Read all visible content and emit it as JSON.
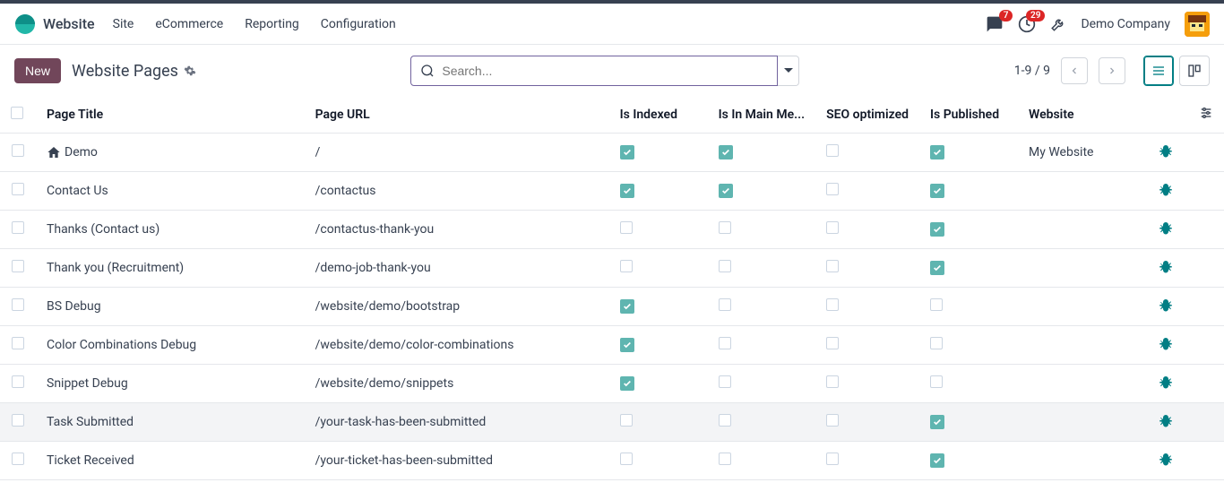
{
  "brand": {
    "name": "Website"
  },
  "nav": {
    "items": [
      "Site",
      "eCommerce",
      "Reporting",
      "Configuration"
    ]
  },
  "notifications": {
    "messages": "7",
    "activities": "29"
  },
  "company": "Demo Company",
  "controls": {
    "new_label": "New",
    "title": "Website Pages",
    "search_placeholder": "Search...",
    "pager": "1-9 / 9"
  },
  "columns": [
    "Page Title",
    "Page URL",
    "Is Indexed",
    "Is In Main Me...",
    "SEO optimized",
    "Is Published",
    "Website"
  ],
  "rows": [
    {
      "title": "Demo",
      "home": true,
      "url": "/",
      "indexed": true,
      "mainmenu": true,
      "seo": false,
      "published": true,
      "website": "My Website",
      "highlight": false
    },
    {
      "title": "Contact Us",
      "home": false,
      "url": "/contactus",
      "indexed": true,
      "mainmenu": true,
      "seo": false,
      "published": true,
      "website": "",
      "highlight": false
    },
    {
      "title": "Thanks (Contact us)",
      "home": false,
      "url": "/contactus-thank-you",
      "indexed": false,
      "mainmenu": false,
      "seo": false,
      "published": true,
      "website": "",
      "highlight": false
    },
    {
      "title": "Thank you (Recruitment)",
      "home": false,
      "url": "/demo-job-thank-you",
      "indexed": false,
      "mainmenu": false,
      "seo": false,
      "published": true,
      "website": "",
      "highlight": false
    },
    {
      "title": "BS Debug",
      "home": false,
      "url": "/website/demo/bootstrap",
      "indexed": true,
      "mainmenu": false,
      "seo": false,
      "published": false,
      "website": "",
      "highlight": false
    },
    {
      "title": "Color Combinations Debug",
      "home": false,
      "url": "/website/demo/color-combinations",
      "indexed": true,
      "mainmenu": false,
      "seo": false,
      "published": false,
      "website": "",
      "highlight": false
    },
    {
      "title": "Snippet Debug",
      "home": false,
      "url": "/website/demo/snippets",
      "indexed": true,
      "mainmenu": false,
      "seo": false,
      "published": false,
      "website": "",
      "highlight": false
    },
    {
      "title": "Task Submitted",
      "home": false,
      "url": "/your-task-has-been-submitted",
      "indexed": false,
      "mainmenu": false,
      "seo": false,
      "published": true,
      "website": "",
      "highlight": true
    },
    {
      "title": "Ticket Received",
      "home": false,
      "url": "/your-ticket-has-been-submitted",
      "indexed": false,
      "mainmenu": false,
      "seo": false,
      "published": true,
      "website": "",
      "highlight": false
    }
  ]
}
